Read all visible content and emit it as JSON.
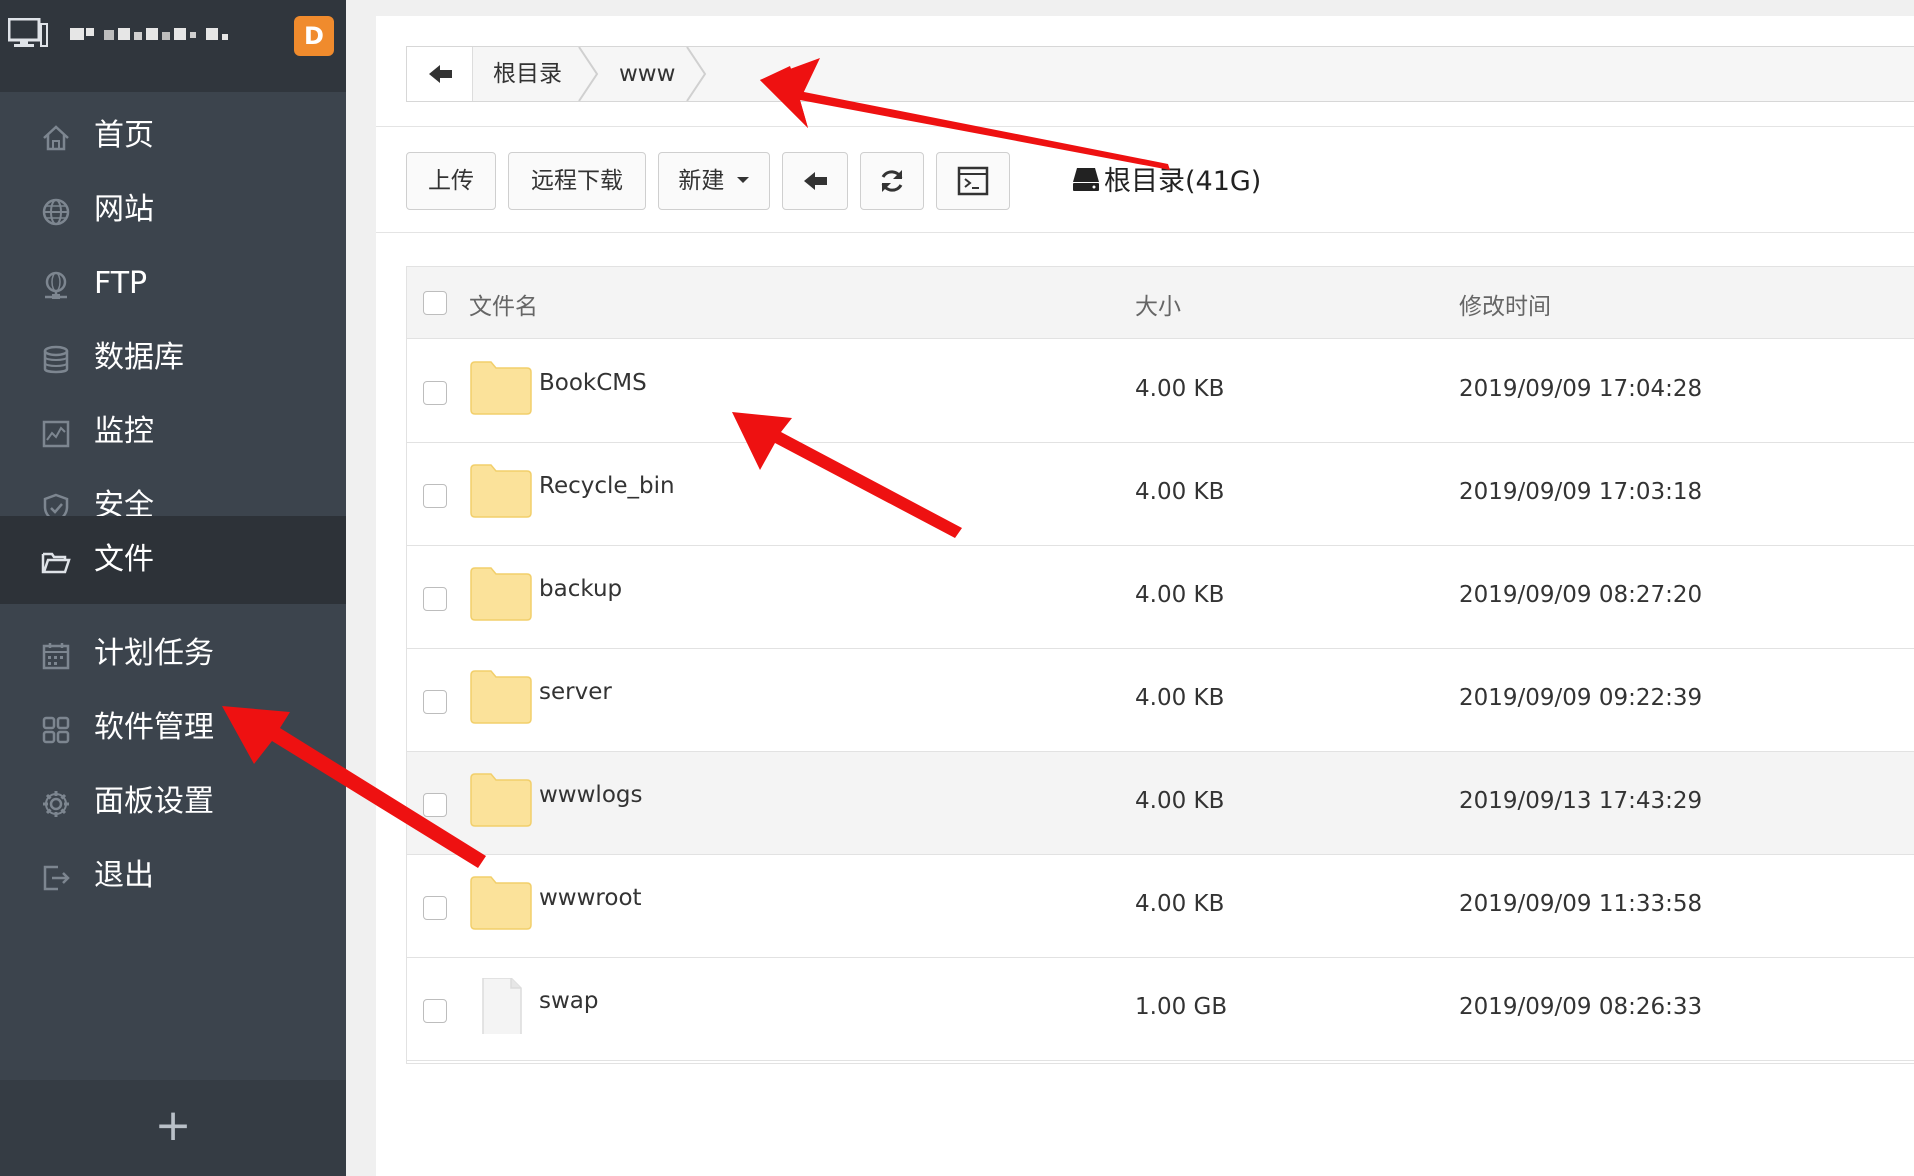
{
  "colors": {
    "sidebar_bg": "#3c444d",
    "sidebar_active_bg": "#2d3238",
    "badge": "#f08b2d",
    "folder": "#fbe29a",
    "annotation_arrow": "#ee1111"
  },
  "logo": {
    "badge_letter": "D",
    "icon": "monitor-icon"
  },
  "sidebar": {
    "items": [
      {
        "label": "首页",
        "icon": "home-icon"
      },
      {
        "label": "网站",
        "icon": "globe-icon"
      },
      {
        "label": "FTP",
        "icon": "ftp-icon"
      },
      {
        "label": "数据库",
        "icon": "database-icon"
      },
      {
        "label": "监控",
        "icon": "monitor-chart-icon"
      },
      {
        "label": "安全",
        "icon": "shield-icon"
      },
      {
        "label": "文件",
        "icon": "folder-open-icon",
        "active": true
      },
      {
        "label": "计划任务",
        "icon": "calendar-icon"
      },
      {
        "label": "软件管理",
        "icon": "grid-icon"
      },
      {
        "label": "面板设置",
        "icon": "gear-icon"
      },
      {
        "label": "退出",
        "icon": "logout-icon"
      }
    ],
    "add_label": "+"
  },
  "breadcrumb": {
    "items": [
      "根目录",
      "www"
    ]
  },
  "toolbar": {
    "upload": "上传",
    "remote_download": "远程下载",
    "new": "新建",
    "disk_label": "根目录(41G)"
  },
  "table": {
    "headers": {
      "name": "文件名",
      "size": "大小",
      "mtime": "修改时间"
    },
    "rows": [
      {
        "name": "BookCMS",
        "size": "4.00 KB",
        "mtime": "2019/09/09 17:04:28",
        "type": "folder"
      },
      {
        "name": "Recycle_bin",
        "size": "4.00 KB",
        "mtime": "2019/09/09 17:03:18",
        "type": "folder"
      },
      {
        "name": "backup",
        "size": "4.00 KB",
        "mtime": "2019/09/09 08:27:20",
        "type": "folder"
      },
      {
        "name": "server",
        "size": "4.00 KB",
        "mtime": "2019/09/09 09:22:39",
        "type": "folder"
      },
      {
        "name": "wwwlogs",
        "size": "4.00 KB",
        "mtime": "2019/09/13 17:43:29",
        "type": "folder"
      },
      {
        "name": "wwwroot",
        "size": "4.00 KB",
        "mtime": "2019/09/09 11:33:58",
        "type": "folder"
      },
      {
        "name": "swap",
        "size": "1.00 GB",
        "mtime": "2019/09/09 08:26:33",
        "type": "file"
      }
    ]
  }
}
